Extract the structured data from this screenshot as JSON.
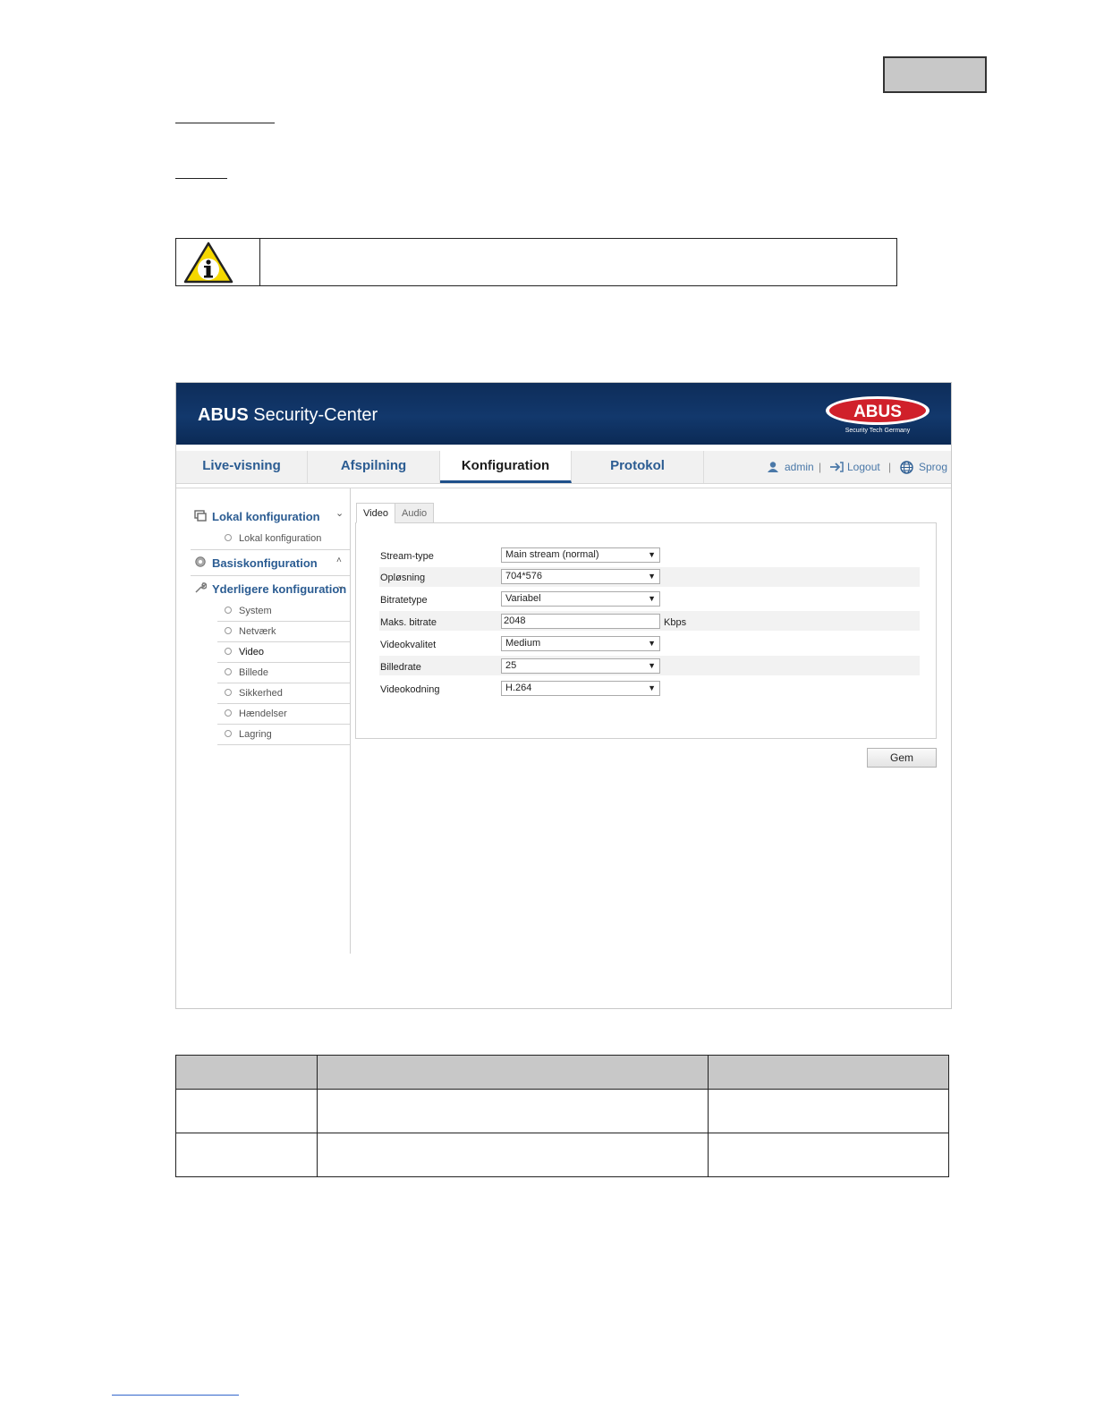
{
  "app": {
    "title_bold": "ABUS",
    "title_rest": " Security-Center",
    "logo_text": "ABUS",
    "logo_tagline": "Security Tech Germany",
    "brand_red": "#d0202a"
  },
  "nav": {
    "tabs": [
      "Live-visning",
      "Afspilning",
      "Konfiguration",
      "Protokol"
    ],
    "active_tab": "Konfiguration",
    "user": "admin",
    "logout": "Logout",
    "language": "Sprog",
    "separator": "|"
  },
  "sidebar": {
    "local_config": "Lokal konfiguration",
    "local_config_sub": "Lokal konfiguration",
    "basic_config": "Basiskonfiguration",
    "advanced_config": "Yderligere konfiguration",
    "advanced_items": [
      "System",
      "Netværk",
      "Video",
      "Billede",
      "Sikkerhed",
      "Hændelser",
      "Lagring"
    ],
    "active_item": "Video"
  },
  "subtabs": [
    "Video",
    "Audio"
  ],
  "form": {
    "stream_type": {
      "label": "Stream-type",
      "value": "Main stream (normal)"
    },
    "resolution": {
      "label": "Opløsning",
      "value": "704*576"
    },
    "bitrate_type": {
      "label": "Bitratetype",
      "value": "Variabel"
    },
    "max_bitrate": {
      "label": "Maks. bitrate",
      "value": "2048",
      "unit": "Kbps"
    },
    "video_quality": {
      "label": "Videokvalitet",
      "value": "Medium"
    },
    "frame_rate": {
      "label": "Billedrate",
      "value": "25"
    },
    "video_encoding": {
      "label": "Videokodning",
      "value": "H.264"
    },
    "save_label": "Gem"
  }
}
